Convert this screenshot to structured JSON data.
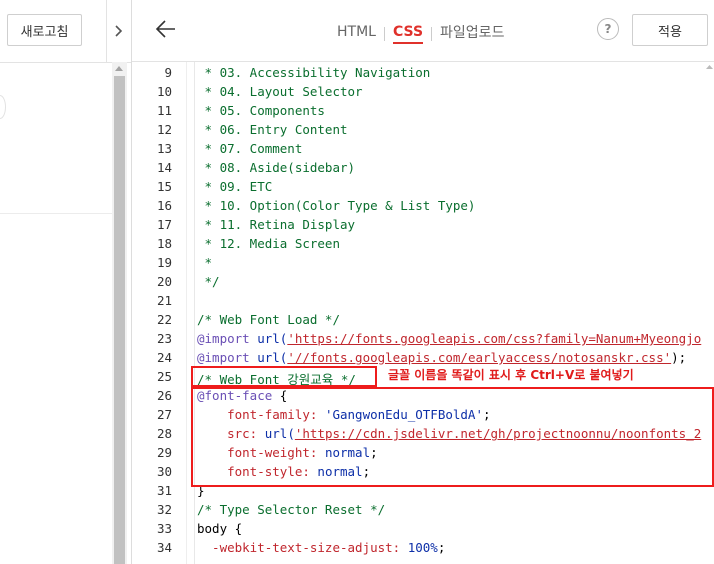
{
  "left": {
    "refresh_label": "새로고침",
    "toggle_icon": "chevron-right"
  },
  "header": {
    "back_icon": "arrow-left",
    "tabs": [
      {
        "label": "HTML",
        "active": false
      },
      {
        "label": "CSS",
        "active": true
      },
      {
        "label": "파일업로드",
        "active": false
      }
    ],
    "help_label": "?",
    "apply_label": "적용"
  },
  "editor": {
    "lines": [
      {
        "n": "9",
        "text": " * 03. Accessibility Navigation"
      },
      {
        "n": "10",
        "text": " * 04. Layout Selector"
      },
      {
        "n": "11",
        "text": " * 05. Components"
      },
      {
        "n": "12",
        "text": " * 06. Entry Content"
      },
      {
        "n": "13",
        "text": " * 07. Comment"
      },
      {
        "n": "14",
        "text": " * 08. Aside(sidebar)"
      },
      {
        "n": "15",
        "text": " * 09. ETC"
      },
      {
        "n": "16",
        "text": " * 10. Option(Color Type & List Type)"
      },
      {
        "n": "17",
        "text": " * 11. Retina Display"
      },
      {
        "n": "18",
        "text": " * 12. Media Screen"
      },
      {
        "n": "19",
        "text": " *"
      },
      {
        "n": "20",
        "text": " */"
      },
      {
        "n": "21",
        "text": ""
      },
      {
        "n": "22",
        "text": "/* Web Font Load */"
      },
      {
        "n": "23",
        "kw": "@import",
        "fn": " url(",
        "url": "'https://fonts.googleapis.com/css?family=Nanum+Myeongjo",
        "rest": ""
      },
      {
        "n": "24",
        "kw": "@import",
        "fn": " url(",
        "url": "'//fonts.googleapis.com/earlyaccess/notosanskr.css'",
        "rest": ");"
      },
      {
        "n": "25",
        "text": "/* Web Font 강원교육 */"
      },
      {
        "n": "26",
        "kw": "@font-face",
        "rest": " {"
      },
      {
        "n": "27",
        "prop": "    font-family:",
        "str": " 'GangwonEdu_OTFBoldA'",
        "rest": ";"
      },
      {
        "n": "28",
        "prop": "    src:",
        "fn": " url(",
        "url": "'https://cdn.jsdelivr.net/gh/projectnoonnu/noonfonts_2",
        "rest": ""
      },
      {
        "n": "29",
        "prop": "    font-weight:",
        "val": " normal",
        "rest": ";"
      },
      {
        "n": "30",
        "prop": "    font-style:",
        "val": " normal",
        "rest": ";"
      },
      {
        "n": "31",
        "text": "}"
      },
      {
        "n": "32",
        "text": "/* Type Selector Reset */"
      },
      {
        "n": "33",
        "text": "body {"
      },
      {
        "n": "34",
        "prop": "  -webkit-text-size-adjust:",
        "val": " 100%",
        "rest": ";"
      }
    ]
  },
  "annotation": "글꼴 이름을 똑같이 표시 후  Ctrl+V로 붙여넣기",
  "colors": {
    "accent": "#e0312b",
    "highlight": "#ee1c1c"
  }
}
